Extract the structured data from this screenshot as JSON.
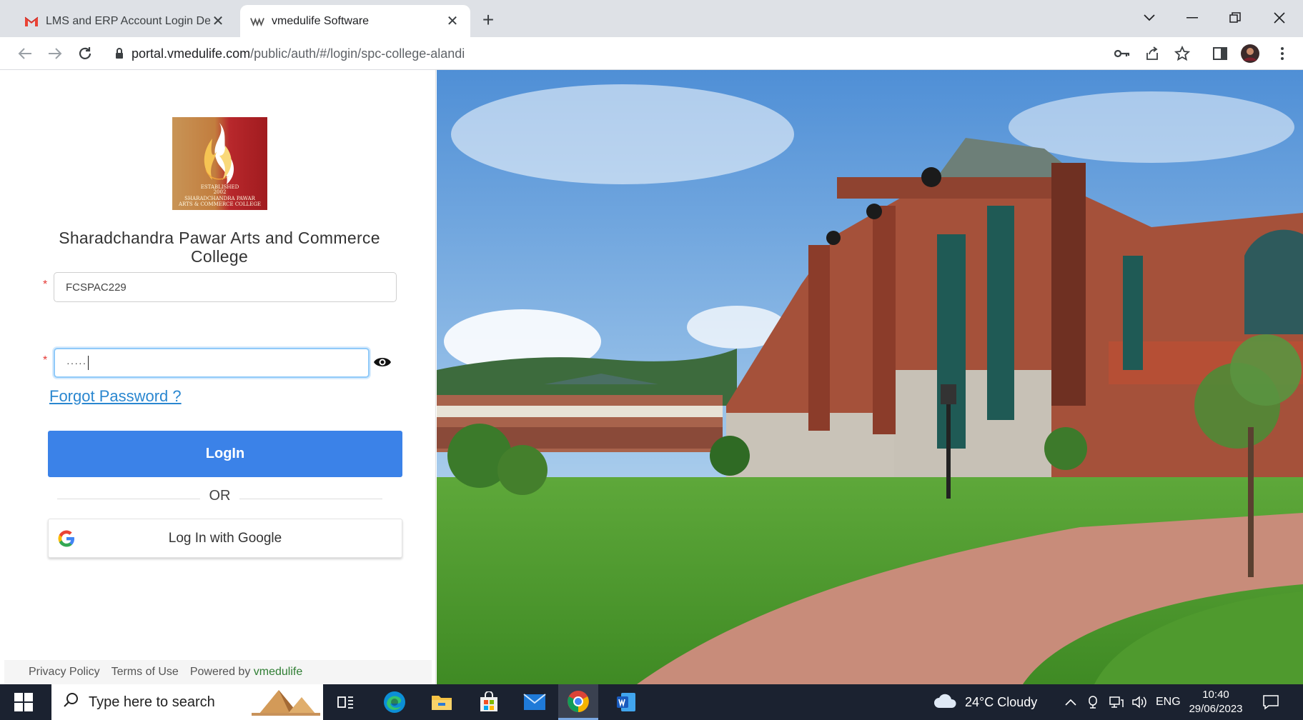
{
  "browser": {
    "tabs": [
      {
        "title": "LMS and ERP Account Login Deta",
        "favicon": "gmail-icon",
        "active": false
      },
      {
        "title": "vmedulife Software",
        "favicon": "vmedulife-icon",
        "active": true
      }
    ],
    "url_host": "portal.vmedulife.com",
    "url_path": "/public/auth/#/login/spc-college-alandi"
  },
  "login": {
    "college_name": "Sharadchandra Pawar Arts and Commerce College",
    "logo": {
      "established_line1": "ESTABLISHED",
      "established_year": "2002",
      "college_line1": "SHARADCHANDRA PAWAR",
      "college_line2": "ARTS & COMMERCE COLLEGE"
    },
    "username_value": "FCSPAC229",
    "password_value": "·····",
    "required_mark": "*",
    "forgot_label": "Forgot Password ?",
    "login_label": "LogIn",
    "or_label": "OR",
    "google_label": "Log In with Google"
  },
  "footer": {
    "privacy": "Privacy Policy",
    "terms": "Terms of Use",
    "powered_by": "Powered by",
    "brand": "vmedulife"
  },
  "taskbar": {
    "search_placeholder": "Type here to search",
    "weather": "24°C  Cloudy",
    "language": "ENG",
    "time": "10:40",
    "date": "29/06/2023"
  },
  "colors": {
    "primary_button": "#3b82e8",
    "link": "#2a87d0",
    "brand_green": "#2e7d32",
    "taskbar_bg": "#1b2230"
  }
}
